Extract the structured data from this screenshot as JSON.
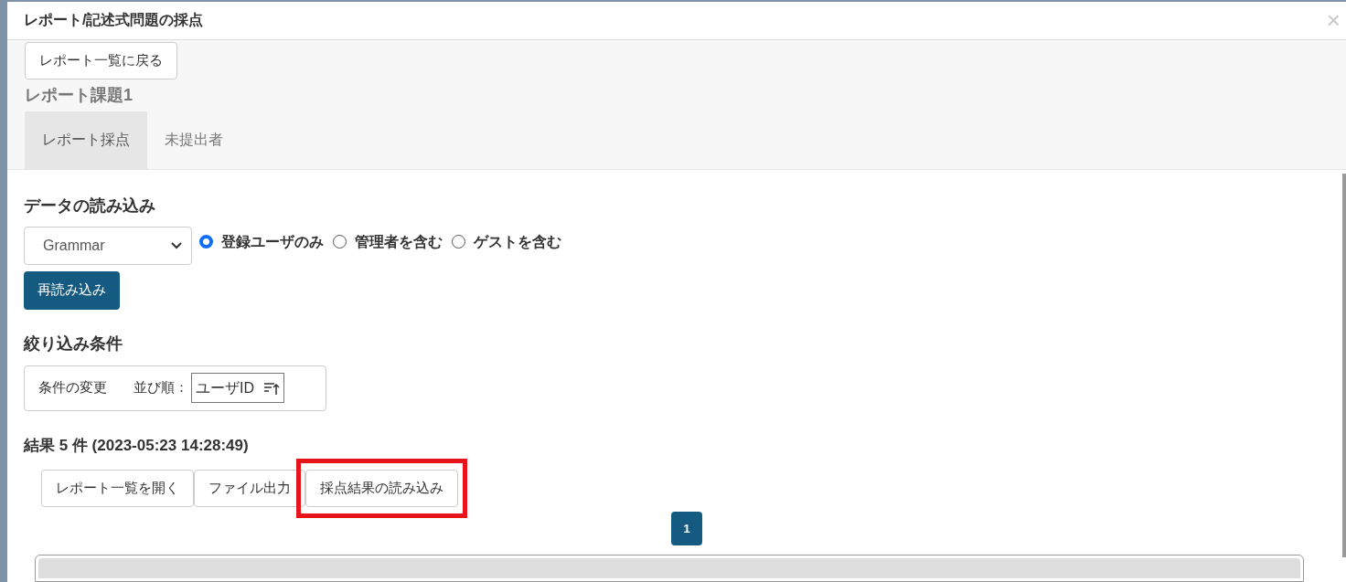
{
  "dialog": {
    "title": "レポート/記述式問題の採点",
    "close": "×"
  },
  "back_button": "レポート一覧に戻る",
  "report_title": "レポート課題1",
  "tabs": [
    {
      "label": "レポート採点",
      "selected": true
    },
    {
      "label": "未提出者",
      "selected": false
    }
  ],
  "data_load": {
    "heading": "データの読み込み",
    "select_value": "Grammar",
    "options": [
      {
        "label": "登録ユーザのみ",
        "selected": true
      },
      {
        "label": "管理者を含む",
        "selected": false
      },
      {
        "label": "ゲストを含む",
        "selected": false
      }
    ],
    "reload_button": "再読み込み"
  },
  "filter": {
    "heading": "絞り込み条件",
    "change_label": "条件の変更",
    "sort_label": "並び順：",
    "sort_value": "ユーザID"
  },
  "results": {
    "summary": "結果 5 件 (2023-05:23 14:28:49)",
    "buttons": [
      {
        "label": "レポート一覧を開く",
        "highlighted": false
      },
      {
        "label": "ファイル出力",
        "highlighted": false
      },
      {
        "label": "採点結果の読み込み",
        "highlighted": true
      }
    ],
    "pages": [
      {
        "label": "1",
        "selected": true
      }
    ]
  }
}
